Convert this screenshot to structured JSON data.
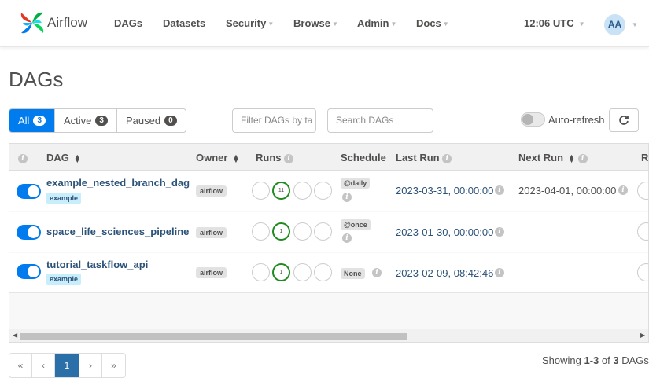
{
  "brand": {
    "name": "Airflow"
  },
  "nav": {
    "items": [
      "DAGs",
      "Datasets",
      "Security",
      "Browse",
      "Admin",
      "Docs"
    ],
    "time": "12:06 UTC",
    "user_initials": "AA"
  },
  "page": {
    "title": "DAGs"
  },
  "filters": {
    "all_label": "All",
    "all_count": "3",
    "active_label": "Active",
    "active_count": "3",
    "paused_label": "Paused",
    "paused_count": "0"
  },
  "search": {
    "tags_placeholder": "Filter DAGs by ta",
    "dags_placeholder": "Search DAGs"
  },
  "autorefresh": {
    "label": "Auto-refresh",
    "enabled": false
  },
  "table": {
    "headers": {
      "dag": "DAG",
      "owner": "Owner",
      "runs": "Runs",
      "schedule": "Schedule",
      "last_run": "Last Run",
      "next_run": "Next Run",
      "recent_tasks_cut": "R"
    },
    "rows": [
      {
        "dag_id": "example_nested_branch_dag",
        "tag": "example",
        "owner": "airflow",
        "success_runs": "11",
        "schedule": "@daily",
        "last_run": "2023-03-31, 00:00:00",
        "next_run": "2023-04-01, 00:00:00",
        "active": true
      },
      {
        "dag_id": "space_life_sciences_pipeline",
        "tag": "",
        "owner": "airflow",
        "success_runs": "1",
        "schedule": "@once",
        "last_run": "2023-01-30, 00:00:00",
        "next_run": "",
        "active": true
      },
      {
        "dag_id": "tutorial_taskflow_api",
        "tag": "example",
        "owner": "airflow",
        "success_runs": "1",
        "schedule": "None",
        "last_run": "2023-02-09, 08:42:46",
        "next_run": "",
        "active": true
      }
    ]
  },
  "pagination": {
    "first": "«",
    "prev": "‹",
    "current": "1",
    "next": "›",
    "last": "»"
  },
  "summary": {
    "prefix": "Showing ",
    "range": "1-3",
    "middle": " of ",
    "total": "3",
    "suffix": " DAGs"
  },
  "colors": {
    "accent": "#017cee",
    "link": "#2b5278",
    "success": "#1f8a1f",
    "tag_bg": "#c9eefb"
  }
}
